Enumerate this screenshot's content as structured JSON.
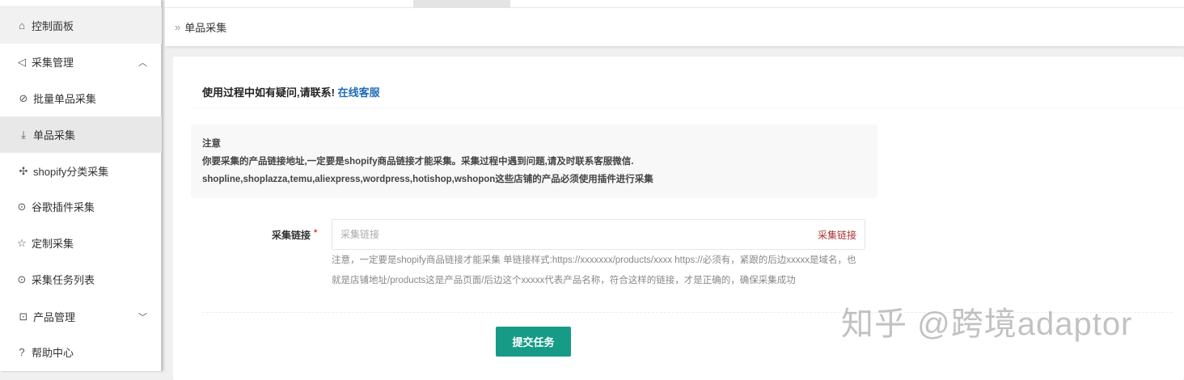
{
  "sidebar": {
    "items": [
      {
        "label": "控制面板",
        "icon": "home-icon"
      },
      {
        "label": "采集管理",
        "icon": "send-icon",
        "chevron": "^"
      },
      {
        "label": "批量单品采集",
        "icon": "leaf-icon"
      },
      {
        "label": "单品采集",
        "icon": "download-icon"
      },
      {
        "label": "shopify分类采集",
        "icon": "grid-icon"
      },
      {
        "label": "谷歌插件采集",
        "icon": "target-icon"
      },
      {
        "label": "定制采集",
        "icon": "star-icon"
      },
      {
        "label": "采集任务列表",
        "icon": "target-icon"
      },
      {
        "label": "产品管理",
        "icon": "bag-icon",
        "chevron": "v"
      },
      {
        "label": "帮助中心",
        "icon": "help-icon"
      }
    ]
  },
  "breadcrumb": {
    "current": "单品采集"
  },
  "help": {
    "text": "使用过程中如有疑问,请联系!",
    "link": "在线客服"
  },
  "notice": {
    "title": "注意",
    "line1": "你要采集的产品链接地址,一定要是shopify商品链接才能采集。采集过程中遇到问题,请及时联系客服微信.",
    "line2": "shopline,shoplazza,temu,aliexpress,wordpress,hotishop,wshopon这些店铺的产品必须使用插件进行采集"
  },
  "form": {
    "label": "采集链接",
    "required": "*",
    "placeholder": "采集链接",
    "suffix": "采集链接",
    "hint": "注意，一定要是shopify商品链接才能采集 单链接样式:https://xxxxxxx/products/xxxx https://必须有，紧跟的后边xxxxx是域名，也就是店铺地址/products这是产品页面/后边这个xxxxx代表产品名称，符合这样的链接，才是正确的，确保采集成功"
  },
  "submit_label": "提交任务",
  "watermark": "知乎 @跨境adaptor",
  "colors": {
    "accent": "#169b87",
    "link": "#1e6bb8"
  }
}
